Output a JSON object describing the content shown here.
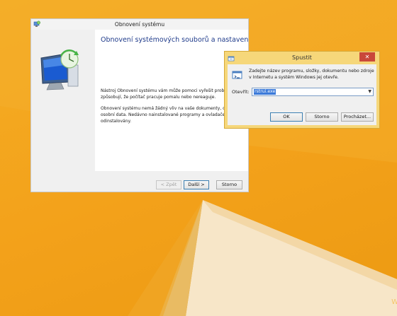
{
  "desktop": {
    "background_color": "#f2a31b",
    "watermark_text": "W"
  },
  "restore_window": {
    "title": "Obnovení systému",
    "heading": "Obnovení systémových souborů a nastavení",
    "paragraph1": "Nástroj Obnovení systému vám může pomoci vyřešit problémy, které způsobují, že počítač pracuje pomalu nebo nereaguje.",
    "paragraph2": "Obnovení systému nemá žádný vliv na vaše dokumenty, obrázky ani jiná osobní data. Nedávno nainstalované programy a ovladače mohou být odinstalovány.",
    "buttons": {
      "back": "< Zpět",
      "next": "Další >",
      "cancel": "Storno"
    },
    "icons": {
      "title_icon": "system-restore-icon",
      "illustration": "restore-monitor-clock-icon"
    }
  },
  "run_dialog": {
    "title": "Spustit",
    "close_glyph": "✕",
    "description": "Zadejte název programu, složky, dokumentu nebo zdroje v Internetu a systém Windows jej otevře.",
    "open_label": "Otevřít:",
    "open_value": "rstrui.exe",
    "buttons": {
      "ok": "OK",
      "cancel": "Storno",
      "browse": "Procházet..."
    },
    "icons": {
      "title_icon": "run-icon",
      "body_icon": "run-icon-large"
    }
  }
}
